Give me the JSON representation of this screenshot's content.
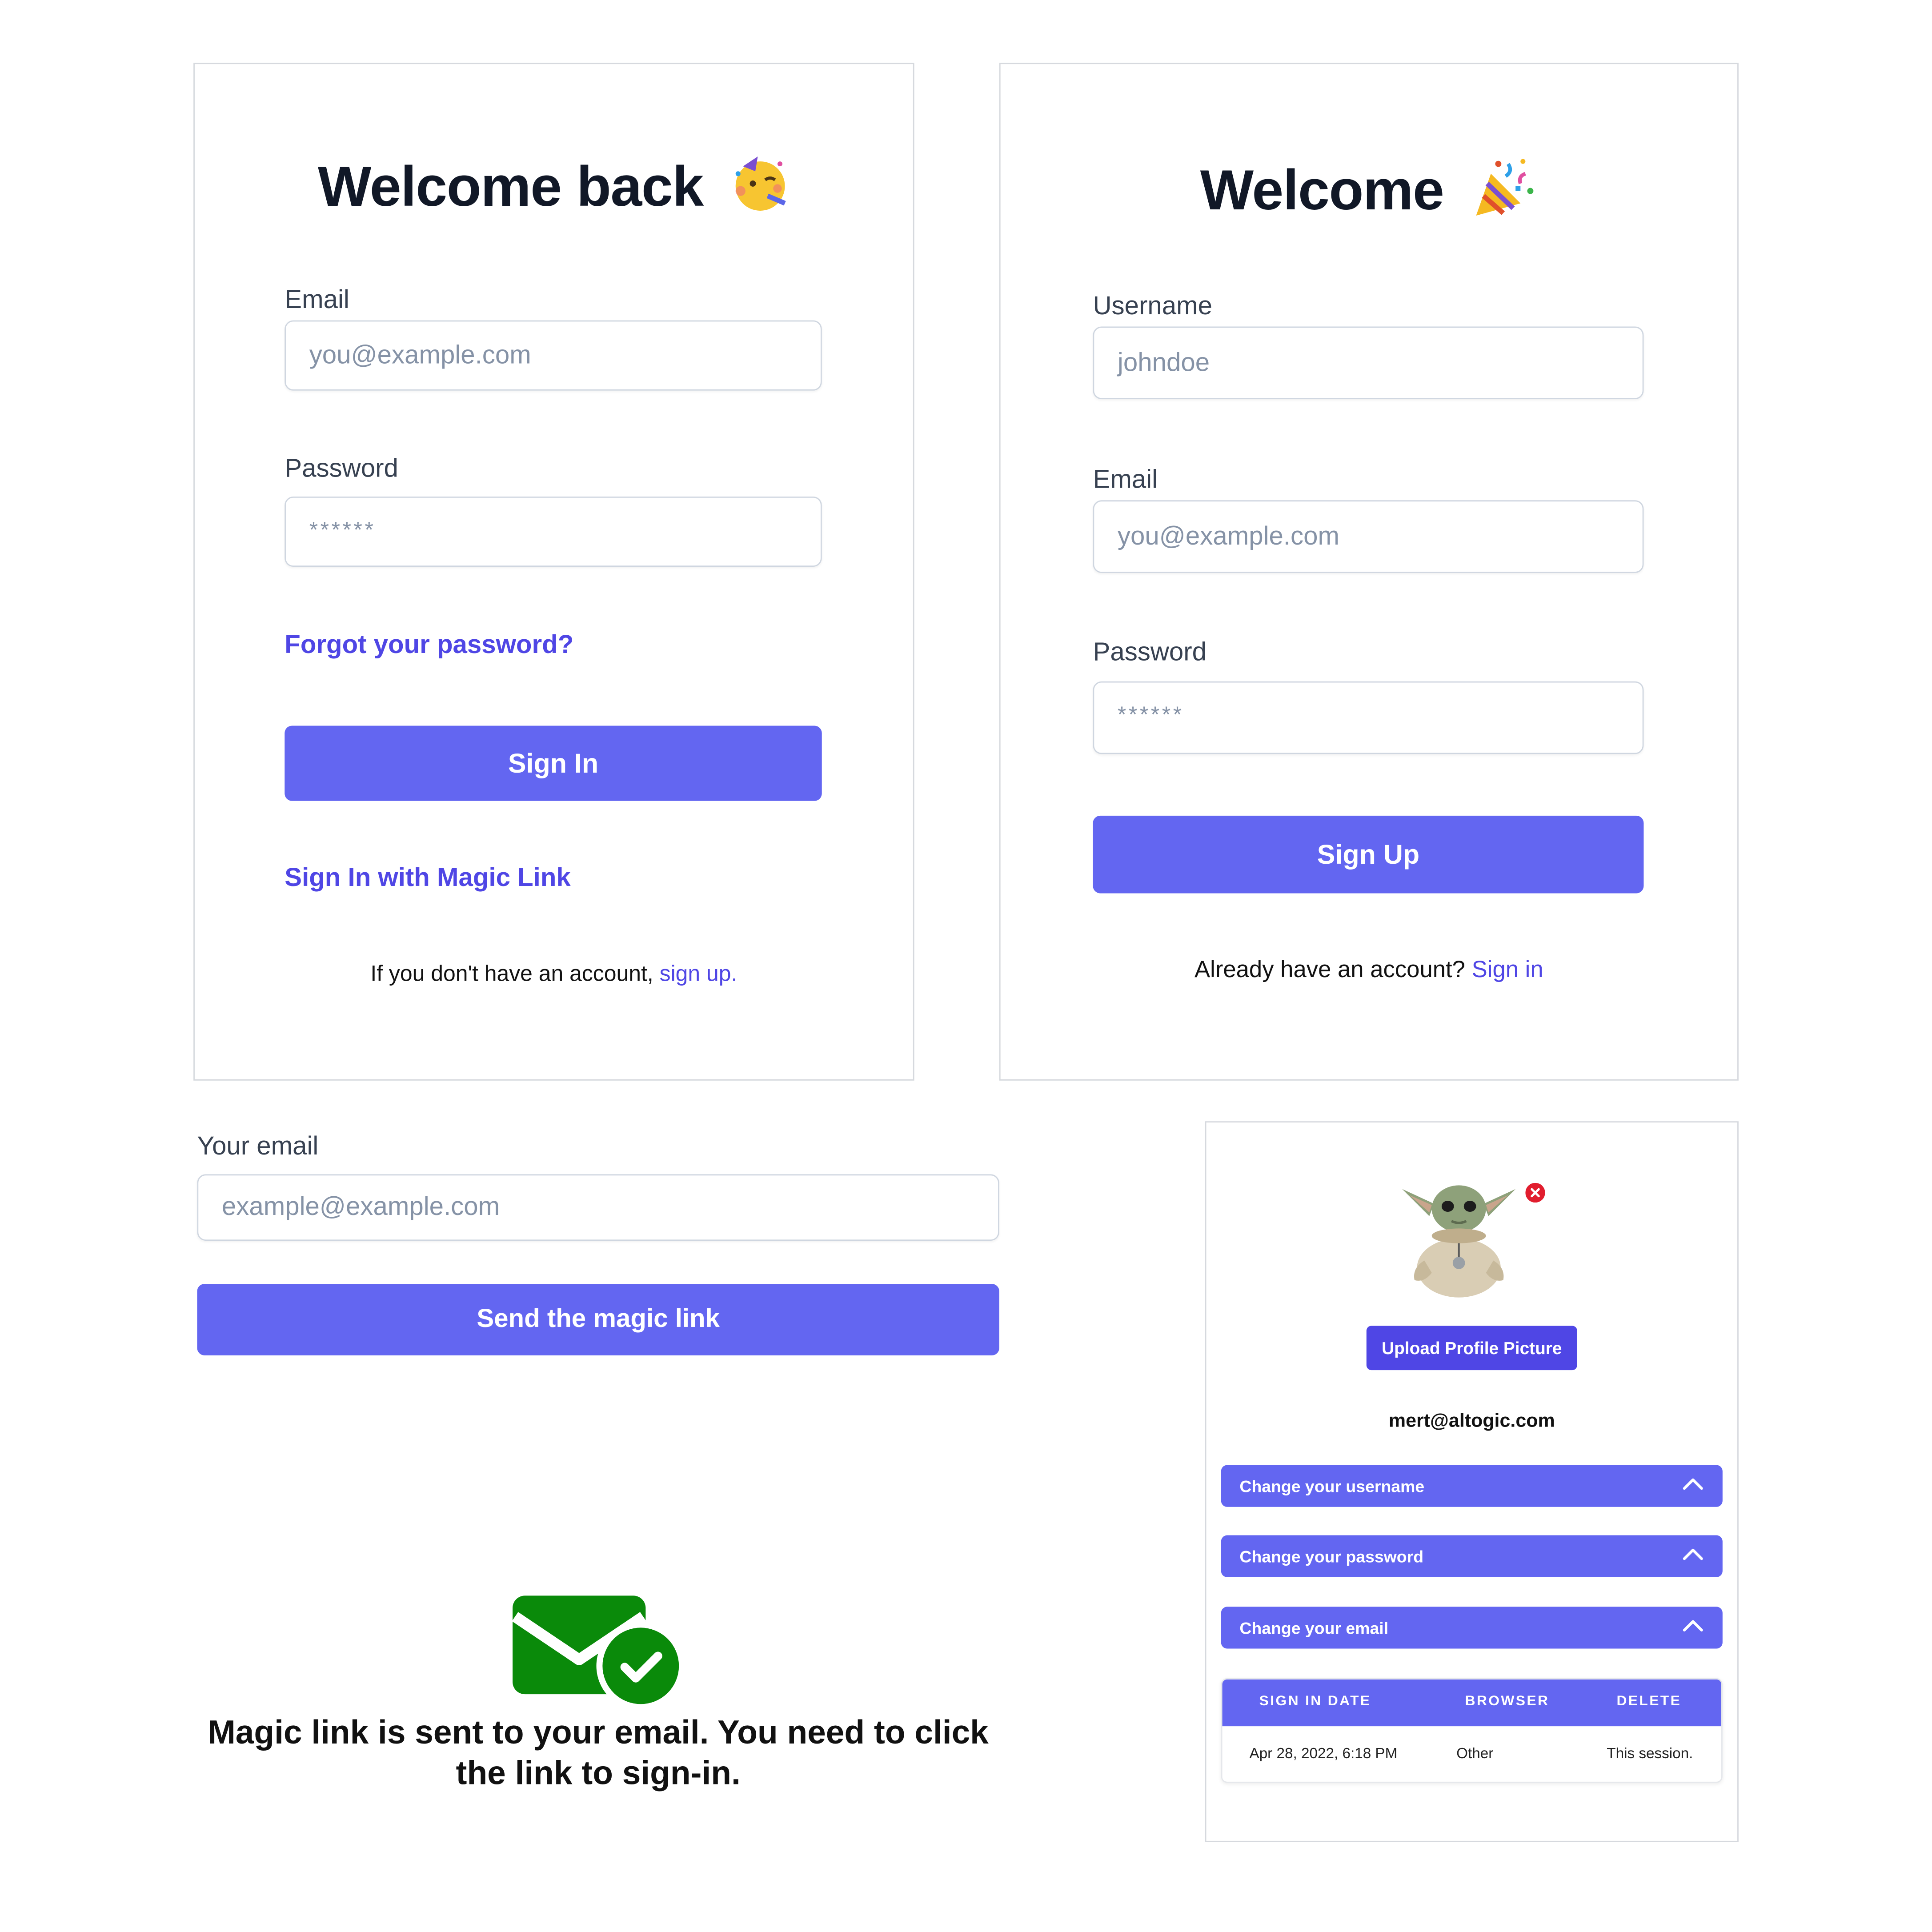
{
  "signin_card": {
    "title": "Welcome back",
    "email_label": "Email",
    "email_placeholder": "you@example.com",
    "password_label": "Password",
    "password_placeholder": "******",
    "forgot_link": "Forgot your password?",
    "signin_button": "Sign In",
    "magic_link": "Sign In with Magic Link",
    "signup_prompt": "If you don't have an account,",
    "signup_link": "sign up."
  },
  "signup_card": {
    "title": "Welcome",
    "username_label": "Username",
    "username_placeholder": "johndoe",
    "email_label": "Email",
    "email_placeholder": "you@example.com",
    "password_label": "Password",
    "password_placeholder": "******",
    "signup_button": "Sign Up",
    "signin_prompt": "Already have an account?",
    "signin_link": "Sign in"
  },
  "magic_form": {
    "email_label": "Your email",
    "email_placeholder": "example@example.com",
    "send_button": "Send the magic link"
  },
  "confirmation": {
    "icon": "mail-check-icon",
    "line1": "Magic link is sent to your email. You need to click",
    "line2": "the link to sign-in."
  },
  "profile": {
    "upload_button": "Upload Profile Picture",
    "email": "mert@altogic.com",
    "accordions": [
      {
        "label": "Change your username"
      },
      {
        "label": "Change your password"
      },
      {
        "label": "Change your email"
      }
    ],
    "sessions": {
      "columns": [
        "SIGN IN DATE",
        "BROWSER",
        "DELETE"
      ],
      "rows": [
        {
          "date": "Apr 28, 2022, 6:18 PM",
          "browser": "Other",
          "delete": "This session."
        }
      ]
    }
  },
  "colors": {
    "accent": "#6366f1",
    "link": "#4f46e5",
    "success": "#0a8a0a",
    "danger": "#e11d2e"
  }
}
